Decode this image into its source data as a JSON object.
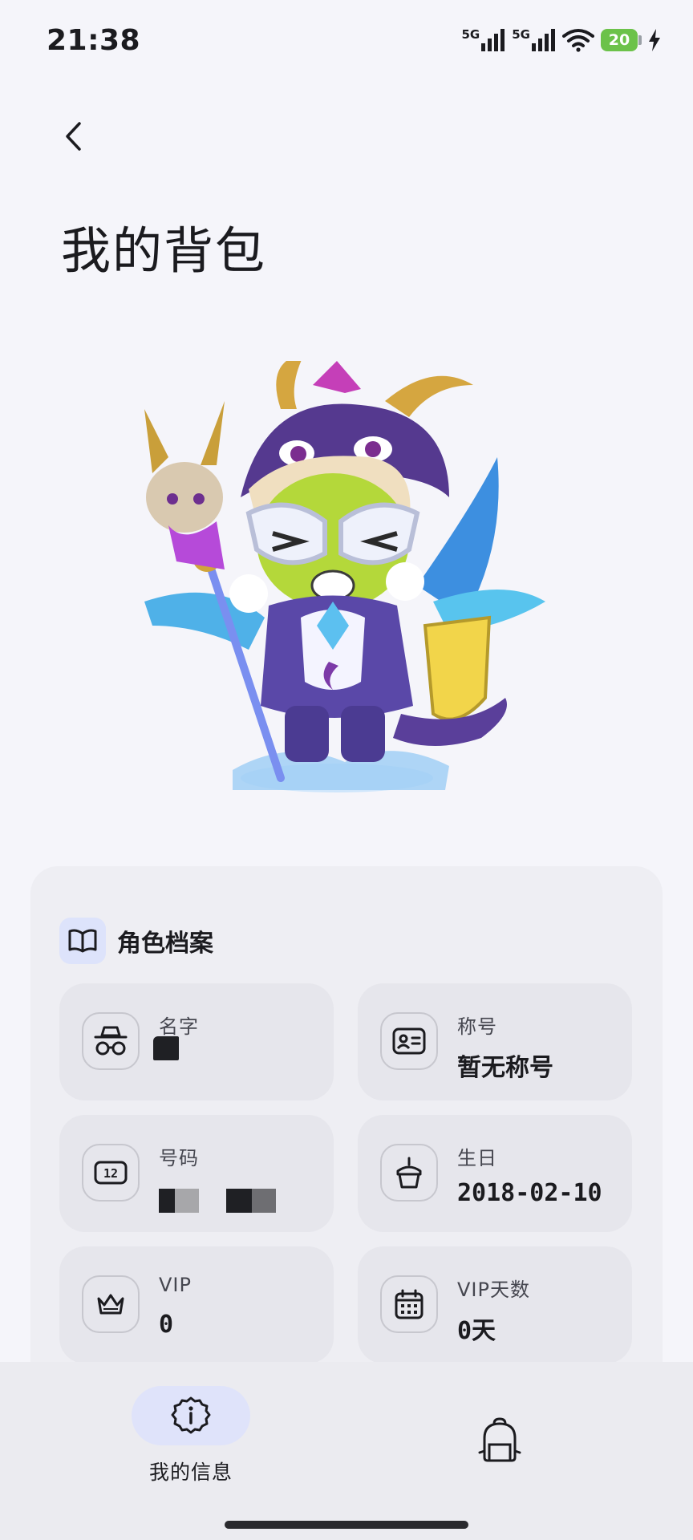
{
  "status_bar": {
    "time": "21:38",
    "signal_1_label": "5G",
    "signal_2_label": "5G",
    "battery_level": "20",
    "icons": [
      "signal-5g-icon",
      "signal-5g-icon",
      "wifi-icon",
      "battery-icon",
      "charging-icon"
    ]
  },
  "header": {
    "title": "我的背包",
    "back_icon": "chevron-left-icon"
  },
  "profile": {
    "section_title": "角色档案",
    "section_icon": "book-open-icon",
    "fields": [
      {
        "label": "名字",
        "value": "",
        "icon": "incognito-icon"
      },
      {
        "label": "称号",
        "value": "暂无称号",
        "icon": "id-card-icon"
      },
      {
        "label": "号码",
        "value": "",
        "icon": "number-12-icon"
      },
      {
        "label": "生日",
        "value": "2018-02-10",
        "icon": "cake-icon"
      },
      {
        "label": "VIP",
        "value": "0",
        "icon": "crown-icon"
      },
      {
        "label": "VIP天数",
        "value": "0天",
        "icon": "calendar-icon"
      }
    ]
  },
  "bottom_nav": {
    "items": [
      {
        "label": "我的信息",
        "icon": "info-icon",
        "active": true
      },
      {
        "label": "",
        "icon": "backpack-icon",
        "active": false
      }
    ]
  },
  "colors": {
    "background": "#f5f5fa",
    "active_pill": "#dfe3fa",
    "battery": "#6cc24a",
    "card": "#e6e6ec"
  }
}
